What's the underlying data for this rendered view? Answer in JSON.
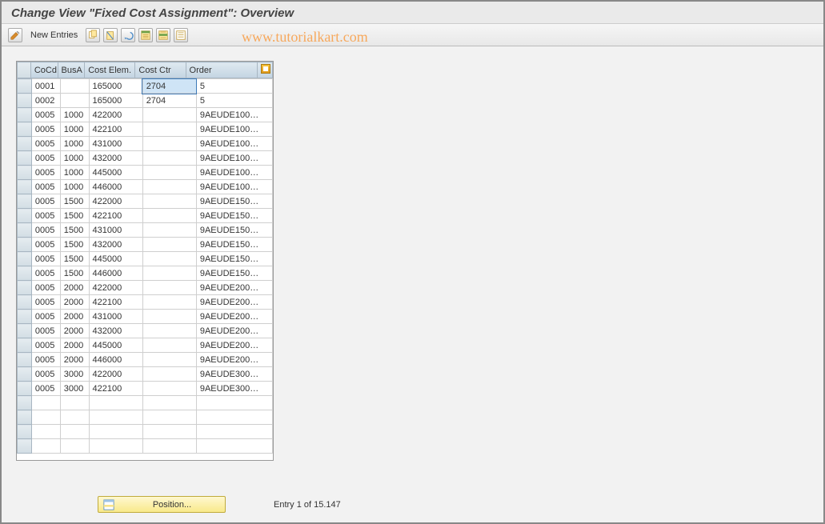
{
  "title": "Change View \"Fixed Cost Assignment\": Overview",
  "toolbar": {
    "edit_tooltip": "Change",
    "new_entries_label": "New Entries",
    "icons": [
      "copy",
      "delete",
      "undo",
      "select-all",
      "select-block",
      "deselect"
    ]
  },
  "watermark": "www.tutorialkart.com",
  "table": {
    "columns": [
      "CoCd",
      "BusA",
      "Cost Elem.",
      "Cost Ctr",
      "Order"
    ],
    "rows": [
      {
        "cocd": "0001",
        "busa": "",
        "costelem": "165000",
        "costctr": "2704",
        "order": "5",
        "selected_cell": "costctr"
      },
      {
        "cocd": "0002",
        "busa": "",
        "costelem": "165000",
        "costctr": "2704",
        "order": "5"
      },
      {
        "cocd": "0005",
        "busa": "1000",
        "costelem": "422000",
        "costctr": "",
        "order": "9AEUDE100…"
      },
      {
        "cocd": "0005",
        "busa": "1000",
        "costelem": "422100",
        "costctr": "",
        "order": "9AEUDE100…"
      },
      {
        "cocd": "0005",
        "busa": "1000",
        "costelem": "431000",
        "costctr": "",
        "order": "9AEUDE100…"
      },
      {
        "cocd": "0005",
        "busa": "1000",
        "costelem": "432000",
        "costctr": "",
        "order": "9AEUDE100…"
      },
      {
        "cocd": "0005",
        "busa": "1000",
        "costelem": "445000",
        "costctr": "",
        "order": "9AEUDE100…"
      },
      {
        "cocd": "0005",
        "busa": "1000",
        "costelem": "446000",
        "costctr": "",
        "order": "9AEUDE100…"
      },
      {
        "cocd": "0005",
        "busa": "1500",
        "costelem": "422000",
        "costctr": "",
        "order": "9AEUDE150…"
      },
      {
        "cocd": "0005",
        "busa": "1500",
        "costelem": "422100",
        "costctr": "",
        "order": "9AEUDE150…"
      },
      {
        "cocd": "0005",
        "busa": "1500",
        "costelem": "431000",
        "costctr": "",
        "order": "9AEUDE150…"
      },
      {
        "cocd": "0005",
        "busa": "1500",
        "costelem": "432000",
        "costctr": "",
        "order": "9AEUDE150…"
      },
      {
        "cocd": "0005",
        "busa": "1500",
        "costelem": "445000",
        "costctr": "",
        "order": "9AEUDE150…"
      },
      {
        "cocd": "0005",
        "busa": "1500",
        "costelem": "446000",
        "costctr": "",
        "order": "9AEUDE150…"
      },
      {
        "cocd": "0005",
        "busa": "2000",
        "costelem": "422000",
        "costctr": "",
        "order": "9AEUDE200…"
      },
      {
        "cocd": "0005",
        "busa": "2000",
        "costelem": "422100",
        "costctr": "",
        "order": "9AEUDE200…"
      },
      {
        "cocd": "0005",
        "busa": "2000",
        "costelem": "431000",
        "costctr": "",
        "order": "9AEUDE200…"
      },
      {
        "cocd": "0005",
        "busa": "2000",
        "costelem": "432000",
        "costctr": "",
        "order": "9AEUDE200…"
      },
      {
        "cocd": "0005",
        "busa": "2000",
        "costelem": "445000",
        "costctr": "",
        "order": "9AEUDE200…"
      },
      {
        "cocd": "0005",
        "busa": "2000",
        "costelem": "446000",
        "costctr": "",
        "order": "9AEUDE200…"
      },
      {
        "cocd": "0005",
        "busa": "3000",
        "costelem": "422000",
        "costctr": "",
        "order": "9AEUDE300…"
      },
      {
        "cocd": "0005",
        "busa": "3000",
        "costelem": "422100",
        "costctr": "",
        "order": "9AEUDE300…"
      }
    ]
  },
  "footer": {
    "position_label": "Position...",
    "entry_text": "Entry 1 of 15.147"
  }
}
